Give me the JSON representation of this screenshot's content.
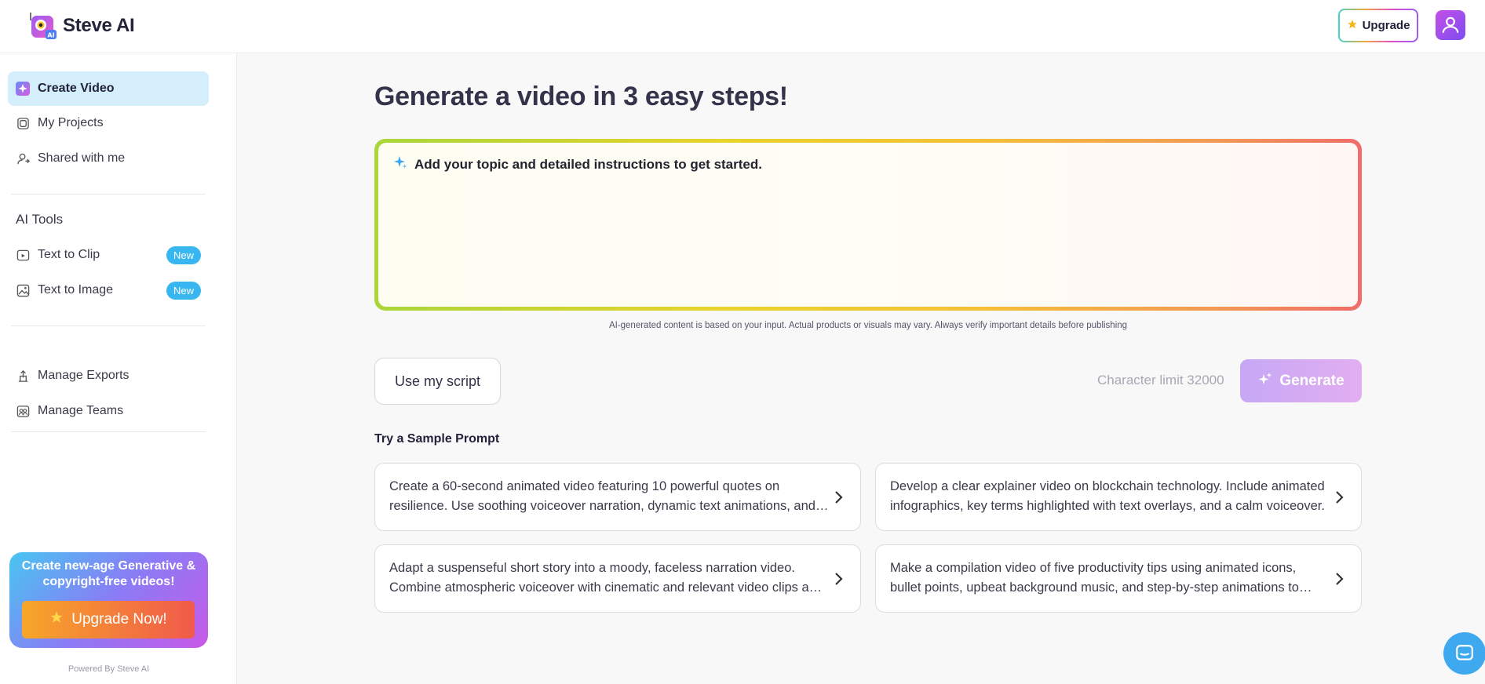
{
  "header": {
    "brand": "Steve AI",
    "upgrade_label": "Upgrade"
  },
  "sidebar": {
    "items": [
      {
        "label": "Create Video",
        "icon": "sparkle-square-icon",
        "active": true
      },
      {
        "label": "My Projects",
        "icon": "projects-icon"
      },
      {
        "label": "Shared with me",
        "icon": "shared-user-icon"
      }
    ],
    "ai_tools_title": "AI Tools",
    "ai_tools": [
      {
        "label": "Text to Clip",
        "icon": "clip-icon",
        "badge": "New"
      },
      {
        "label": "Text to Image",
        "icon": "image-icon",
        "badge": "New"
      }
    ],
    "manage": [
      {
        "label": "Manage Exports",
        "icon": "exports-icon"
      },
      {
        "label": "Manage Teams",
        "icon": "teams-icon"
      }
    ],
    "promo": {
      "text": "Create new-age Generative & copyright-free videos!",
      "button": "Upgrade Now!"
    },
    "powered_by": "Powered By Steve AI"
  },
  "main": {
    "title": "Generate a video in 3 easy steps!",
    "prompt_placeholder": "Add your topic and detailed instructions to get started.",
    "disclaimer": "AI-generated content is based on your input. Actual products or visuals may vary. Always verify important details before publishing",
    "script_button": "Use my script",
    "char_limit": "Character limit 32000",
    "generate_button": "Generate",
    "sample_title": "Try a Sample Prompt",
    "samples": [
      "Create a 60-second animated video featuring 10 powerful quotes on resilience. Use soothing voiceover narration, dynamic text animations, and uplifting background music.",
      "Develop a clear explainer video on blockchain technology. Include animated infographics, key terms highlighted with text overlays, and a calm voiceover.",
      "Adapt a suspenseful short story into a moody, faceless narration video. Combine atmospheric voiceover with cinematic and relevant video clips and subtle music.",
      "Make a compilation video of five productivity tips using animated icons, bullet points, upbeat background music, and step-by-step animations to keep viewers engaged."
    ]
  },
  "colors": {
    "active_nav_bg": "#d4eefb",
    "badge": "#38b6f0",
    "generate_button": "#c6a8f4",
    "chat_bubble": "#3fa9f0"
  }
}
